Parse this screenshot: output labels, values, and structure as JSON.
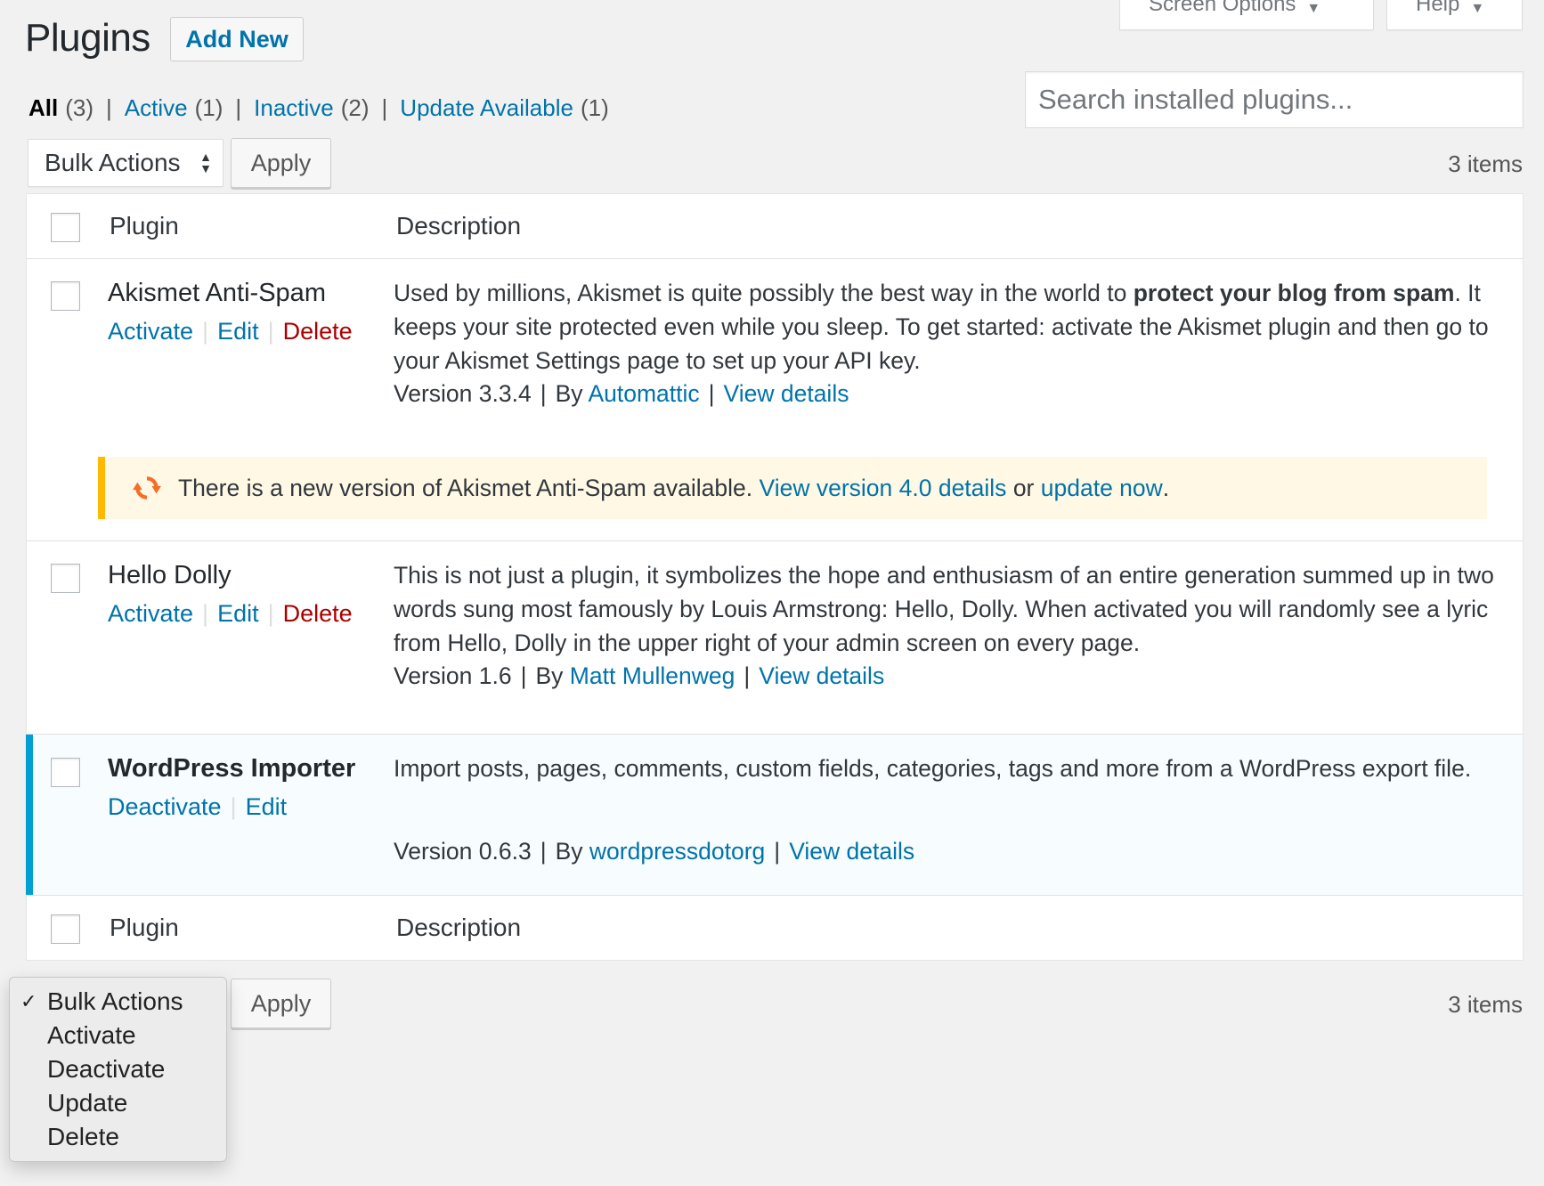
{
  "header": {
    "screen_options_label": "Screen Options",
    "help_label": "Help",
    "title": "Plugins",
    "add_new_label": "Add New"
  },
  "filters": [
    {
      "label": "All",
      "count": "(3)",
      "current": true
    },
    {
      "label": "Active",
      "count": "(1)"
    },
    {
      "label": "Inactive",
      "count": "(2)"
    },
    {
      "label": "Update Available",
      "count": "(1)"
    }
  ],
  "filter_separator": "|",
  "search": {
    "placeholder": "Search installed plugins..."
  },
  "bulk_top": {
    "select_label": "Bulk Actions",
    "apply_label": "Apply",
    "items_count": "3 items"
  },
  "table": {
    "col_plugin": "Plugin",
    "col_description": "Description"
  },
  "plugins": [
    {
      "name": "Akismet Anti-Spam",
      "actions": {
        "primary": "Activate",
        "edit": "Edit",
        "delete": "Delete"
      },
      "description_pre": "Used by millions, Akismet is quite possibly the best way in the world to ",
      "description_bold": "protect your blog from spam",
      "description_post": ". It keeps your site protected even while you sleep. To get started: activate the Akismet plugin and then go to your Akismet Settings page to set up your API key.",
      "version": "Version 3.3.4",
      "by": "By",
      "author": "Automattic",
      "view_details": "View details",
      "update_notice": {
        "text": "There is a new version of Akismet Anti-Spam available.",
        "details_link": "View version 4.0 details",
        "or": "or",
        "update_link": "update now",
        "end": "."
      }
    },
    {
      "name": "Hello Dolly",
      "actions": {
        "primary": "Activate",
        "edit": "Edit",
        "delete": "Delete"
      },
      "description": "This is not just a plugin, it symbolizes the hope and enthusiasm of an entire generation summed up in two words sung most famously by Louis Armstrong: Hello, Dolly. When activated you will randomly see a lyric from Hello, Dolly in the upper right of your admin screen on every page.",
      "version": "Version 1.6",
      "by": "By",
      "author": "Matt Mullenweg",
      "view_details": "View details"
    },
    {
      "name": "WordPress Importer",
      "active": true,
      "actions": {
        "primary": "Deactivate",
        "edit": "Edit"
      },
      "description": "Import posts, pages, comments, custom fields, categories, tags and more from a WordPress export file.",
      "version": "Version 0.6.3",
      "by": "By",
      "author": "wordpressdotorg",
      "view_details": "View details"
    }
  ],
  "bulk_bottom": {
    "apply_label": "Apply",
    "items_count": "3 items",
    "options": [
      "Bulk Actions",
      "Activate",
      "Deactivate",
      "Update",
      "Delete"
    ],
    "selected": "Bulk Actions"
  },
  "colors": {
    "link": "#0073aa",
    "delete": "#aa0000",
    "active_bar": "#00a0d2",
    "notice_border": "#ffb900",
    "notice_bg": "#fff8e5",
    "update_icon": "#f56e28"
  }
}
